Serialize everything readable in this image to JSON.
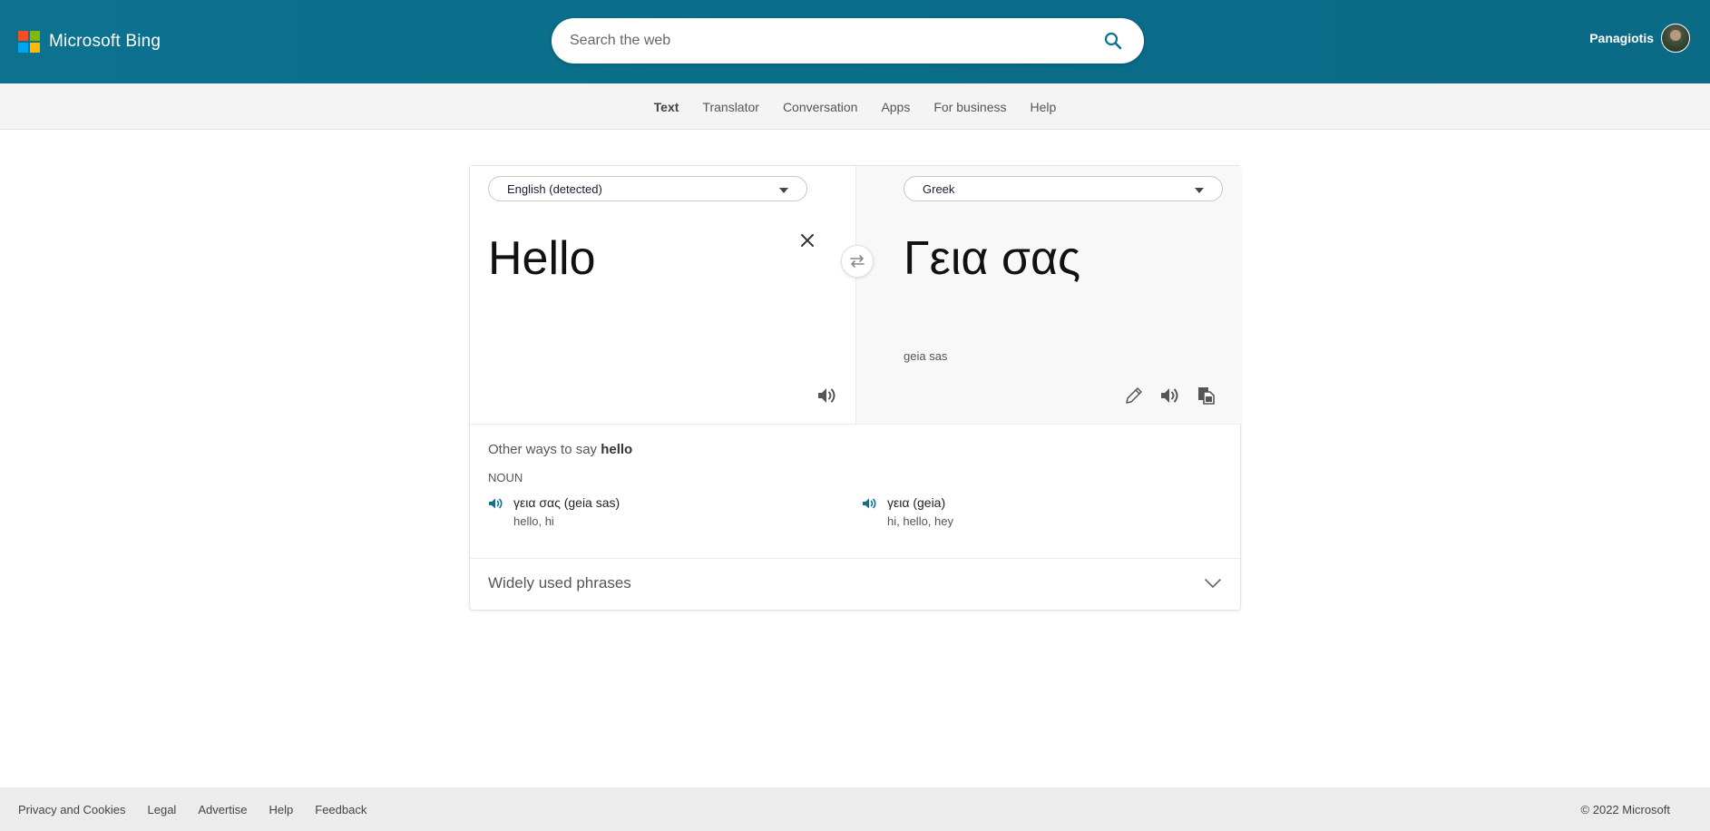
{
  "header": {
    "brand": "Microsoft Bing",
    "search_placeholder": "Search the web",
    "user_name": "Panagiotis"
  },
  "subnav": {
    "items": [
      "Text",
      "Translator",
      "Conversation",
      "Apps",
      "For business",
      "Help"
    ],
    "active": "Text"
  },
  "translator": {
    "source_language": "English (detected)",
    "target_language": "Greek",
    "source_text": "Hello",
    "target_text": "Γεια σας",
    "transliteration": "geia sas"
  },
  "other_ways": {
    "title_prefix": "Other ways to say",
    "word": "hello",
    "part_of_speech": "NOUN",
    "alternatives": [
      {
        "word": "γεια σας (geia sas)",
        "back_translations": "hello, hi"
      },
      {
        "word": "γεια (geia)",
        "back_translations": "hi, hello, hey"
      }
    ]
  },
  "phrases": {
    "label": "Widely used phrases"
  },
  "footer": {
    "links": [
      "Privacy and Cookies",
      "Legal",
      "Advertise",
      "Help",
      "Feedback"
    ],
    "copyright": "© 2022 Microsoft"
  },
  "colors": {
    "header_bg": "#0b6e8a",
    "accent": "#0c7290",
    "subnav_bg": "#f4f4f4",
    "footer_bg": "#ececec"
  }
}
